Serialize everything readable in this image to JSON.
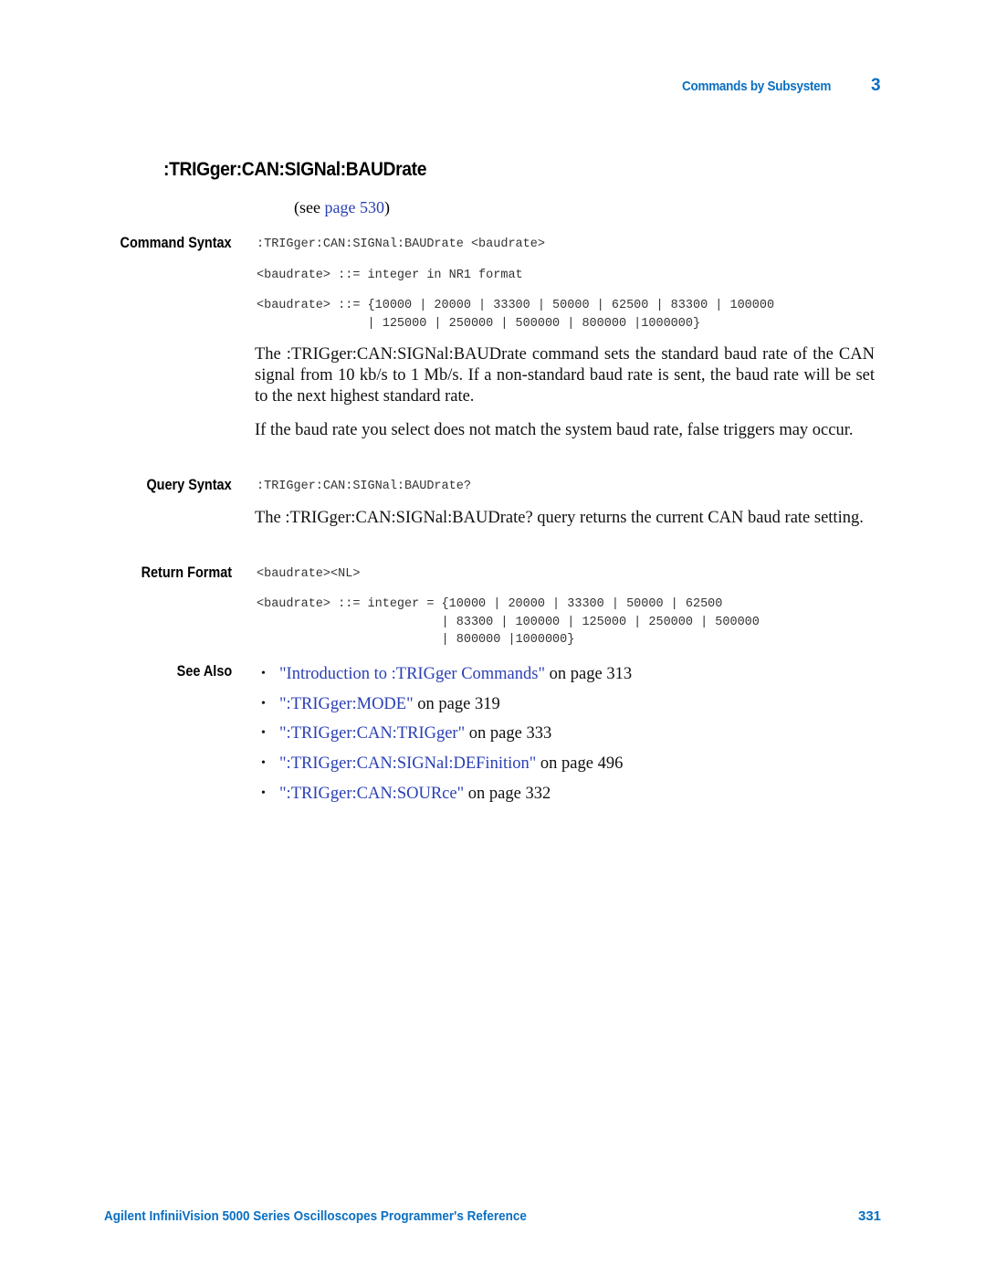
{
  "header": {
    "section": "Commands by Subsystem",
    "chapter": "3"
  },
  "title": ":TRIGger:CAN:SIGNal:BAUDrate",
  "see_page": {
    "prefix": "(see ",
    "link_label": "page 530",
    "suffix": ")"
  },
  "command_syntax": {
    "label": "Command Syntax",
    "lines": [
      ":TRIGger:CAN:SIGNal:BAUDrate <baudrate>",
      "<baudrate> ::= integer in NR1 format",
      "<baudrate> ::= {10000 | 20000 | 33300 | 50000 | 62500 | 83300 | 100000\n               | 125000 | 250000 | 500000 | 800000 |1000000}"
    ],
    "description": [
      "The :TRIGger:CAN:SIGNal:BAUDrate command sets the standard baud rate of the CAN signal from 10 kb/s to 1 Mb/s. If a non-standard baud rate is sent, the baud rate will be set to the next highest standard rate.",
      "If the baud rate you select does not match the system baud rate, false triggers may occur."
    ]
  },
  "query_syntax": {
    "label": "Query Syntax",
    "line": ":TRIGger:CAN:SIGNal:BAUDrate?",
    "description": "The :TRIGger:CAN:SIGNal:BAUDrate? query returns the current CAN baud rate setting."
  },
  "return_format": {
    "label": "Return Format",
    "line": "<baudrate><NL>",
    "definition": "<baudrate> ::= integer = {10000 | 20000 | 33300 | 50000 | 62500\n                         | 83300 | 100000 | 125000 | 250000 | 500000\n                         | 800000 |1000000}"
  },
  "see_also": {
    "label": "See Also",
    "items": [
      {
        "link": "\"Introduction to :TRIGger Commands\"",
        "suffix": " on page 313"
      },
      {
        "link": "\":TRIGger:MODE\"",
        "suffix": " on page 319"
      },
      {
        "link": "\":TRIGger:CAN:TRIGger\"",
        "suffix": " on page 333"
      },
      {
        "link": "\":TRIGger:CAN:SIGNal:DEFinition\"",
        "suffix": " on page 496"
      },
      {
        "link": "\":TRIGger:CAN:SOURce\"",
        "suffix": " on page 332"
      }
    ],
    "bullet": "•"
  },
  "footer": {
    "title": "Agilent InfiniiVision 5000 Series Oscilloscopes Programmer's Reference",
    "page": "331"
  }
}
